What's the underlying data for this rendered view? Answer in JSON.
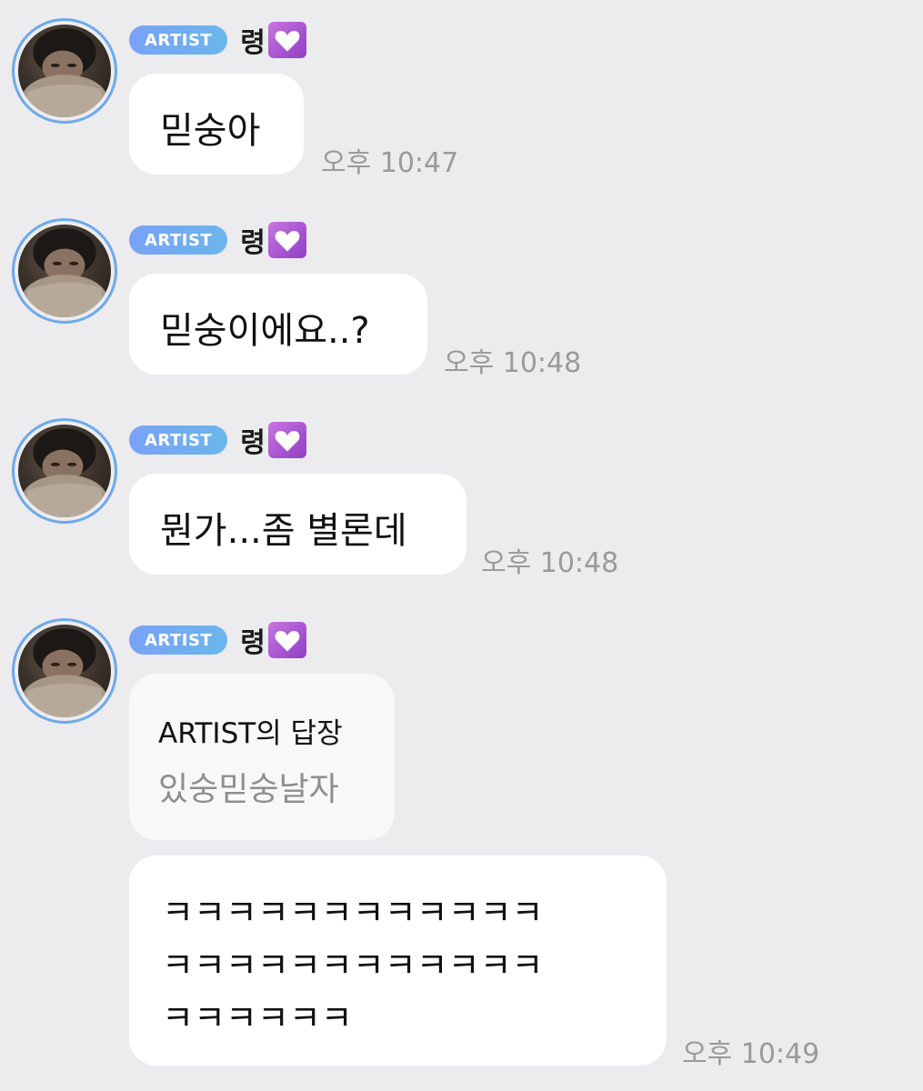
{
  "messages": [
    {
      "badge": "ARTIST",
      "sender": "령",
      "text": "믿숭아",
      "time": "오후 10:47"
    },
    {
      "badge": "ARTIST",
      "sender": "령",
      "text": "믿숭이에요..?",
      "time": "오후 10:48"
    },
    {
      "badge": "ARTIST",
      "sender": "령",
      "text": "뭔가...좀 별론데",
      "time": "오후 10:48"
    },
    {
      "badge": "ARTIST",
      "sender": "령",
      "reply_title": "ARTIST의 답장",
      "reply_quote": "있숭믿숭날자",
      "lines": [
        "ㅋㅋㅋㅋㅋㅋㅋㅋㅋㅋㅋㅋ",
        "ㅋㅋㅋㅋㅋㅋㅋㅋㅋㅋㅋㅋ",
        "ㅋㅋㅋㅋㅋㅋ"
      ],
      "time": "오후 10:49"
    }
  ],
  "colors": {
    "background": "#ececee",
    "badge": "#7aa2f7",
    "heart": "#a855d6",
    "avatar_ring": "#6ea9ec"
  }
}
